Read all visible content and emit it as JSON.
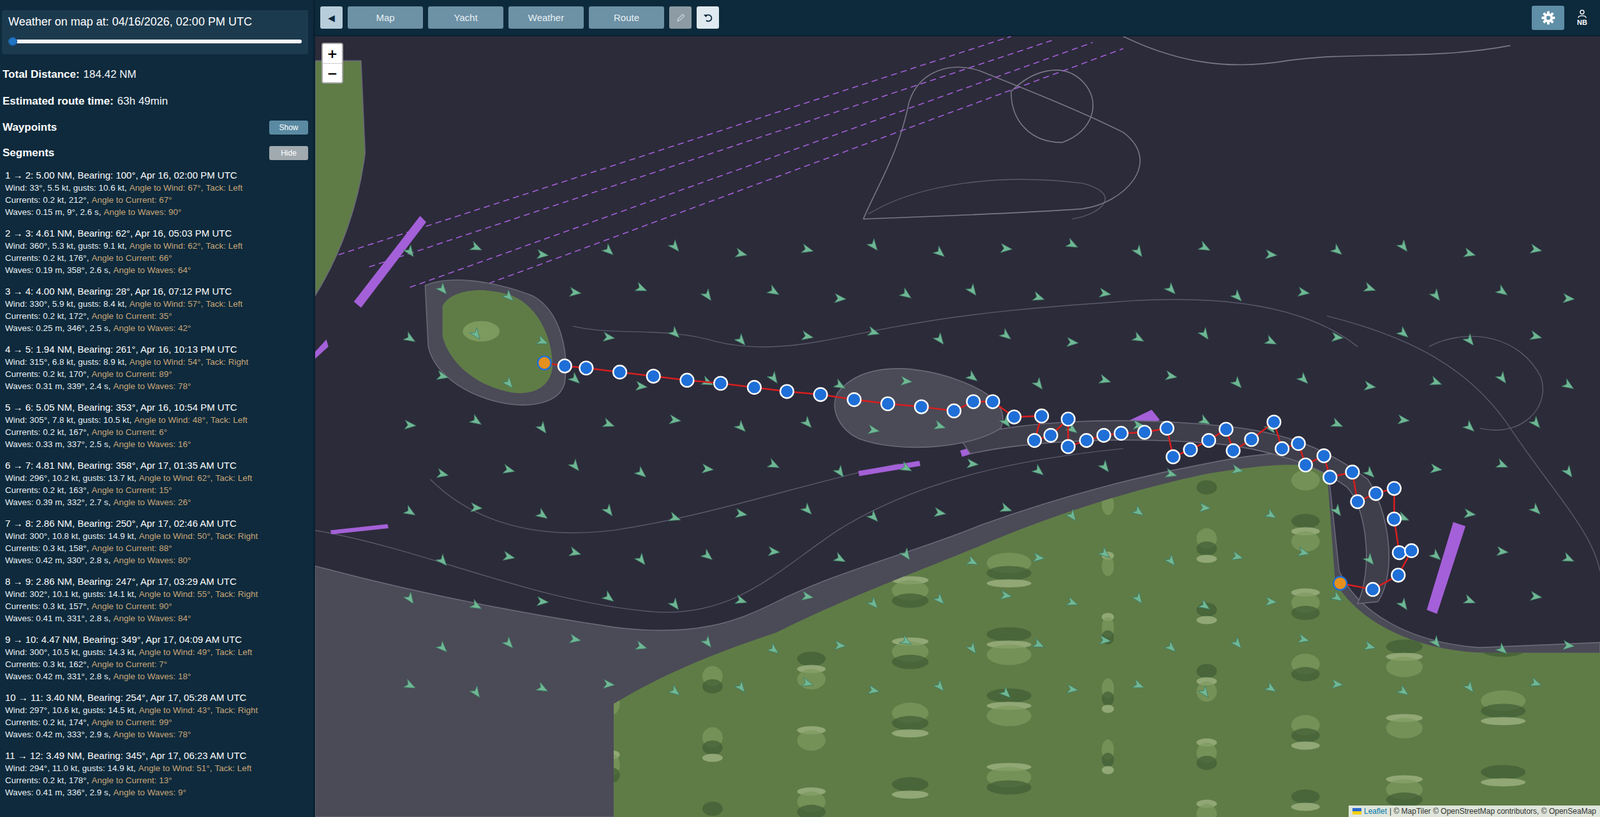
{
  "sidebar": {
    "weather": {
      "title": "Weather on map at: 04/16/2026, 02:00 PM UTC",
      "level": 0.0
    },
    "summary": [
      {
        "label": "Total Distance:",
        "value": "184.42 NM"
      },
      {
        "label": "Estimated route time:",
        "value": "63h 49min"
      }
    ],
    "sections": [
      {
        "label": "Waypoints",
        "button": "Show",
        "expanded": false
      },
      {
        "label": "Segments",
        "button": "Hide",
        "expanded": true
      }
    ],
    "segments": [
      {
        "title": "1 → 2: 5.00 NM, Bearing: 100°, Apr 16, 02:00 PM UTC",
        "wind": "Wind: 33°, 5.5 kt, gusts: 10.6 kt,",
        "wind_angle": "Angle to Wind: 67°,",
        "tack": "Tack: Left",
        "currents": "Currents: 0.2 kt, 212°,",
        "current_angle": "Angle to Current: 67°",
        "waves": "Waves: 0.15 m, 9°, 2.6 s,",
        "wave_angle": "Angle to Waves: 90°"
      },
      {
        "title": "2 → 3: 4.61 NM, Bearing: 62°, Apr 16, 05:03 PM UTC",
        "wind": "Wind: 360°, 5.3 kt, gusts: 9.1 kt,",
        "wind_angle": "Angle to Wind: 62°,",
        "tack": "Tack: Left",
        "currents": "Currents: 0.2 kt, 176°,",
        "current_angle": "Angle to Current: 66°",
        "waves": "Waves: 0.19 m, 358°, 2.6 s,",
        "wave_angle": "Angle to Waves: 64°"
      },
      {
        "title": "3 → 4: 4.00 NM, Bearing: 28°, Apr 16, 07:12 PM UTC",
        "wind": "Wind: 330°, 5.9 kt, gusts: 8.4 kt,",
        "wind_angle": "Angle to Wind: 57°,",
        "tack": "Tack: Left",
        "currents": "Currents: 0.2 kt, 172°,",
        "current_angle": "Angle to Current: 35°",
        "waves": "Waves: 0.25 m, 346°, 2.5 s,",
        "wave_angle": "Angle to Waves: 42°"
      },
      {
        "title": "4 → 5: 1.94 NM, Bearing: 261°, Apr 16, 10:13 PM UTC",
        "wind": "Wind: 315°, 6.8 kt, gusts: 8.9 kt,",
        "wind_angle": "Angle to Wind: 54°,",
        "tack": "Tack: Right",
        "currents": "Currents: 0.2 kt, 170°,",
        "current_angle": "Angle to Current: 89°",
        "waves": "Waves: 0.31 m, 339°, 2.4 s,",
        "wave_angle": "Angle to Waves: 78°"
      },
      {
        "title": "5 → 6: 5.05 NM, Bearing: 353°, Apr 16, 10:54 PM UTC",
        "wind": "Wind: 305°, 7.8 kt, gusts: 10.5 kt,",
        "wind_angle": "Angle to Wind: 48°,",
        "tack": "Tack: Left",
        "currents": "Currents: 0.2 kt, 167°,",
        "current_angle": "Angle to Current: 6°",
        "waves": "Waves: 0.33 m, 337°, 2.5 s,",
        "wave_angle": "Angle to Waves: 16°"
      },
      {
        "title": "6 → 7: 4.81 NM, Bearing: 358°, Apr 17, 01:35 AM UTC",
        "wind": "Wind: 296°, 10.2 kt, gusts: 13.7 kt,",
        "wind_angle": "Angle to Wind: 62°,",
        "tack": "Tack: Left",
        "currents": "Currents: 0.2 kt, 163°,",
        "current_angle": "Angle to Current: 15°",
        "waves": "Waves: 0.39 m, 332°, 2.7 s,",
        "wave_angle": "Angle to Waves: 26°"
      },
      {
        "title": "7 → 8: 2.86 NM, Bearing: 250°, Apr 17, 02:46 AM UTC",
        "wind": "Wind: 300°, 10.8 kt, gusts: 14.9 kt,",
        "wind_angle": "Angle to Wind: 50°,",
        "tack": "Tack: Right",
        "currents": "Currents: 0.3 kt, 158°,",
        "current_angle": "Angle to Current: 88°",
        "waves": "Waves: 0.42 m, 330°, 2.8 s,",
        "wave_angle": "Angle to Waves: 80°"
      },
      {
        "title": "8 → 9: 2.86 NM, Bearing: 247°, Apr 17, 03:29 AM UTC",
        "wind": "Wind: 302°, 10.1 kt, gusts: 14.1 kt,",
        "wind_angle": "Angle to Wind: 55°,",
        "tack": "Tack: Right",
        "currents": "Currents: 0.3 kt, 157°,",
        "current_angle": "Angle to Current: 90°",
        "waves": "Waves: 0.41 m, 331°, 2.8 s,",
        "wave_angle": "Angle to Waves: 84°"
      },
      {
        "title": "9 → 10: 4.47 NM, Bearing: 349°, Apr 17, 04:09 AM UTC",
        "wind": "Wind: 300°, 10.5 kt, gusts: 14.3 kt,",
        "wind_angle": "Angle to Wind: 49°,",
        "tack": "Tack: Left",
        "currents": "Currents: 0.3 kt, 162°,",
        "current_angle": "Angle to Current: 7°",
        "waves": "Waves: 0.42 m, 331°, 2.8 s,",
        "wave_angle": "Angle to Waves: 18°"
      },
      {
        "title": "10 → 11: 3.40 NM, Bearing: 254°, Apr 17, 05:28 AM UTC",
        "wind": "Wind: 297°, 10.6 kt, gusts: 14.5 kt,",
        "wind_angle": "Angle to Wind: 43°,",
        "tack": "Tack: Right",
        "currents": "Currents: 0.2 kt, 174°,",
        "current_angle": "Angle to Current: 99°",
        "waves": "Waves: 0.42 m, 333°, 2.9 s,",
        "wave_angle": "Angle to Waves: 78°"
      },
      {
        "title": "11 → 12: 3.49 NM, Bearing: 345°, Apr 17, 06:23 AM UTC",
        "wind": "Wind: 294°, 11.0 kt, gusts: 14.9 kt,",
        "wind_angle": "Angle to Wind: 51°,",
        "tack": "Tack: Left",
        "currents": "Currents: 0.2 kt, 178°,",
        "current_angle": "Angle to Current: 13°",
        "waves": "Waves: 0.41 m, 336°, 2.9 s,",
        "wave_angle": "Angle to Waves: 9°"
      }
    ]
  },
  "toolbar": {
    "toggle": "◀",
    "tabs": [
      {
        "label": "Map",
        "selected": false
      },
      {
        "label": "Yacht",
        "selected": false
      },
      {
        "label": "Weather",
        "selected": false
      },
      {
        "label": "Route",
        "selected": false
      }
    ],
    "edit_disabled": true,
    "undo_disabled": false,
    "user": "NB"
  },
  "map": {
    "zoom_in": "+",
    "zoom_out": "−",
    "attribution": {
      "leaflet": "Leaflet",
      "rest": "| © MapTiler © OpenStreetMap contributors, © OpenSeaMap"
    },
    "waypoints": [
      "start",
      "via",
      "via",
      "via",
      "via",
      "via",
      "via",
      "via",
      "via",
      "via",
      "via",
      "via",
      "via",
      "via",
      "via",
      "via",
      "via",
      "via",
      "via",
      "via",
      "via",
      "via",
      "via",
      "via",
      "via",
      "via",
      "via",
      "via",
      "via",
      "via",
      "via",
      "via",
      "via",
      "via",
      "via",
      "via",
      "via",
      "via",
      "via",
      "via",
      "via",
      "via",
      "via",
      "via",
      "via",
      "via",
      "via",
      "via",
      "end"
    ]
  }
}
